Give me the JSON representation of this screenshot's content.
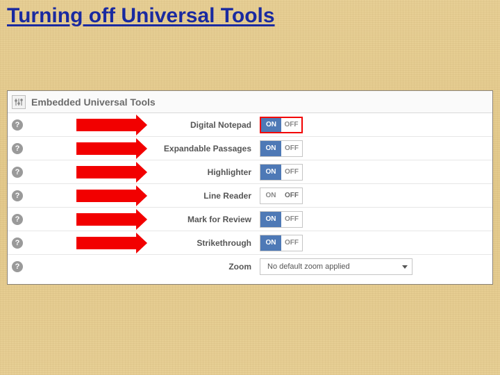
{
  "slide": {
    "title": "Turning off Universal Tools"
  },
  "panel": {
    "header": "Embedded Universal Tools",
    "toggle_text": {
      "on": "ON",
      "off": "OFF"
    }
  },
  "rows": [
    {
      "label": "Digital Notepad",
      "state": "on",
      "arrow": true,
      "highlight": true,
      "control": "toggle"
    },
    {
      "label": "Expandable Passages",
      "state": "on",
      "arrow": true,
      "highlight": false,
      "control": "toggle"
    },
    {
      "label": "Highlighter",
      "state": "on",
      "arrow": true,
      "highlight": false,
      "control": "toggle"
    },
    {
      "label": "Line Reader",
      "state": "off",
      "arrow": true,
      "highlight": false,
      "control": "toggle"
    },
    {
      "label": "Mark for Review",
      "state": "on",
      "arrow": true,
      "highlight": false,
      "control": "toggle"
    },
    {
      "label": "Strikethrough",
      "state": "on",
      "arrow": true,
      "highlight": false,
      "control": "toggle"
    },
    {
      "label": "Zoom",
      "state": "",
      "arrow": false,
      "highlight": false,
      "control": "dropdown",
      "value": "No default zoom applied"
    }
  ]
}
